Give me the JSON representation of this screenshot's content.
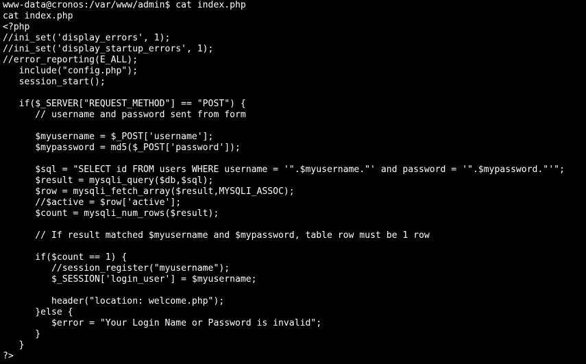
{
  "terminal": {
    "prompt": "www-data@cronos:/var/www/admin$ cat index.php",
    "lines": [
      "cat index.php",
      "<?php",
      "//ini_set('display_errors', 1);",
      "//ini_set('display_startup_errors', 1);",
      "//error_reporting(E_ALL);",
      "   include(\"config.php\");",
      "   session_start();",
      "",
      "   if($_SERVER[\"REQUEST_METHOD\"] == \"POST\") {",
      "      // username and password sent from form",
      "",
      "      $myusername = $_POST['username'];",
      "      $mypassword = md5($_POST['password']);",
      "",
      "      $sql = \"SELECT id FROM users WHERE username = '\".$myusername.\"' and password = '\".$mypassword.\"'\";",
      "      $result = mysqli_query($db,$sql);",
      "      $row = mysqli_fetch_array($result,MYSQLI_ASSOC);",
      "      //$active = $row['active'];",
      "      $count = mysqli_num_rows($result);",
      "",
      "      // If result matched $myusername and $mypassword, table row must be 1 row",
      "",
      "      if($count == 1) {",
      "         //session_register(\"myusername\");",
      "         $_SESSION['login_user'] = $myusername;",
      "",
      "         header(\"location: welcome.php\");",
      "      }else {",
      "         $error = \"Your Login Name or Password is invalid\";",
      "      }",
      "   }",
      "?>"
    ]
  }
}
